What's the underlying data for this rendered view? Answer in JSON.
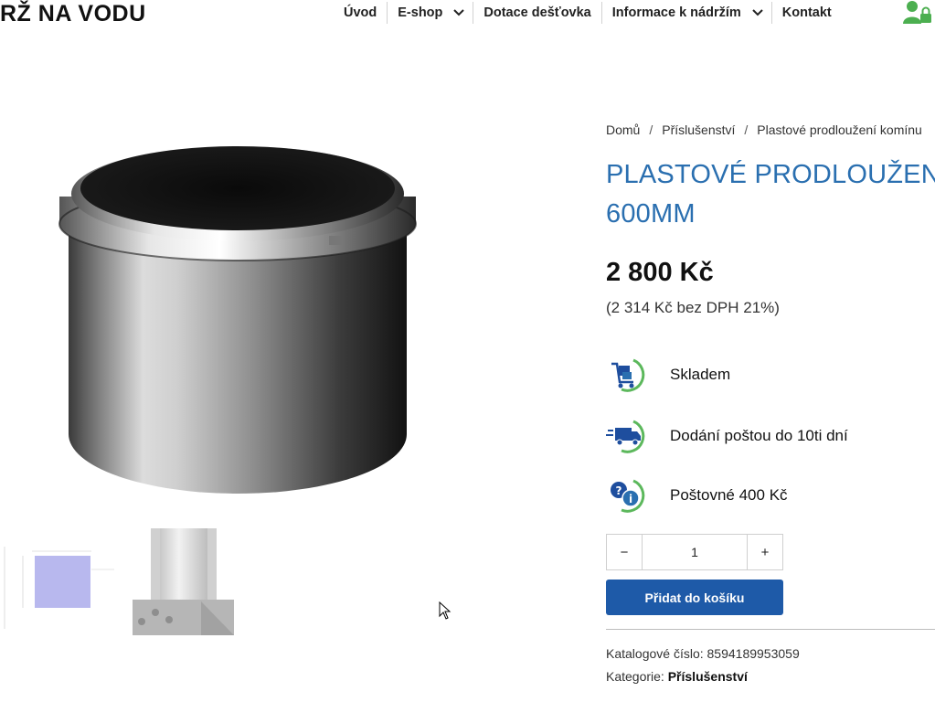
{
  "header": {
    "logo_text": "RŽ NA VODU",
    "nav": [
      {
        "label": "Úvod"
      },
      {
        "label": "E-shop"
      },
      {
        "label": "Dotace dešťovka"
      },
      {
        "label": "Informace k nádržím"
      },
      {
        "label": "Kontakt"
      }
    ],
    "user_icon": "user-lock-icon",
    "colors": {
      "user_icon": "#4caf50"
    }
  },
  "breadcrumb": {
    "items": [
      "Domů",
      "Příslušenství",
      "Plastové prodloužení komínu"
    ],
    "separator": "/"
  },
  "product": {
    "title_line1": "PLASTOVÉ PRODLOUŽENÍ",
    "title_line2": "600MM",
    "price": "2 800 Kč",
    "price_net": "(2 314 Kč bez DPH 21%)",
    "features": [
      {
        "icon": "delivery-cart-icon",
        "label": "Skladem"
      },
      {
        "icon": "delivery-truck-icon",
        "label": "Dodání poštou do 10ti dní"
      },
      {
        "icon": "info-question-icon",
        "label": "Poštovné 400 Kč"
      }
    ],
    "quantity": "1",
    "qty_minus": "−",
    "qty_plus": "+",
    "add_to_cart_label": "Přidat do košíku",
    "catalog_label": "Katalogové číslo:",
    "catalog_number": "8594189953059",
    "category_label": "Kategorie:",
    "category_value": "Příslušenství",
    "colors": {
      "title": "#2a6fb0",
      "button": "#1e5aa8",
      "icon_green": "#5cb85c"
    }
  }
}
